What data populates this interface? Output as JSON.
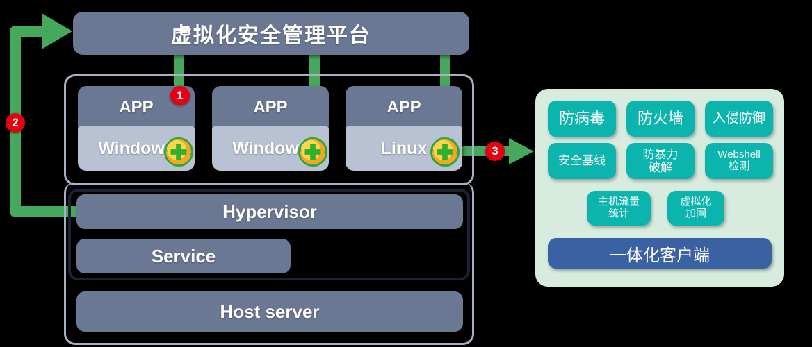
{
  "platform": {
    "title": "虚拟化安全管理平台"
  },
  "vms": [
    {
      "app_label": "APP",
      "os_label": "Windows",
      "icon": "security-shield-plus-icon"
    },
    {
      "app_label": "APP",
      "os_label": "Windows",
      "icon": "security-shield-plus-icon"
    },
    {
      "app_label": "APP",
      "os_label": "Linux",
      "icon": "security-shield-plus-icon"
    }
  ],
  "stack": {
    "hypervisor": "Hypervisor",
    "service": "Service",
    "host_server": "Host server"
  },
  "badges": [
    {
      "number": "1"
    },
    {
      "number": "2"
    },
    {
      "number": "3"
    }
  ],
  "security_panel": {
    "row1": [
      {
        "label": "防病毒"
      },
      {
        "label": "防火墙"
      },
      {
        "label": "入侵防御"
      }
    ],
    "row2": [
      {
        "label": "安全基线"
      },
      {
        "label": "防暴力\n破解"
      },
      {
        "label": "Webshell\n检测"
      }
    ],
    "row3": [
      {
        "label": "主机流量\n统计"
      },
      {
        "label": "虚拟化\n加固"
      }
    ],
    "client": "一体化客户端"
  },
  "colors": {
    "slate": "#6b7894",
    "os_light": "#b9c2d2",
    "green_arrow": "#46a85c",
    "badge_red": "#e60012",
    "panel_bg": "#d7ecdf",
    "pill_teal": "#0bb5ae",
    "client_blue": "#3a62a3",
    "frame_light": "#a7b0c0",
    "frame_dark": "#1b2233"
  }
}
